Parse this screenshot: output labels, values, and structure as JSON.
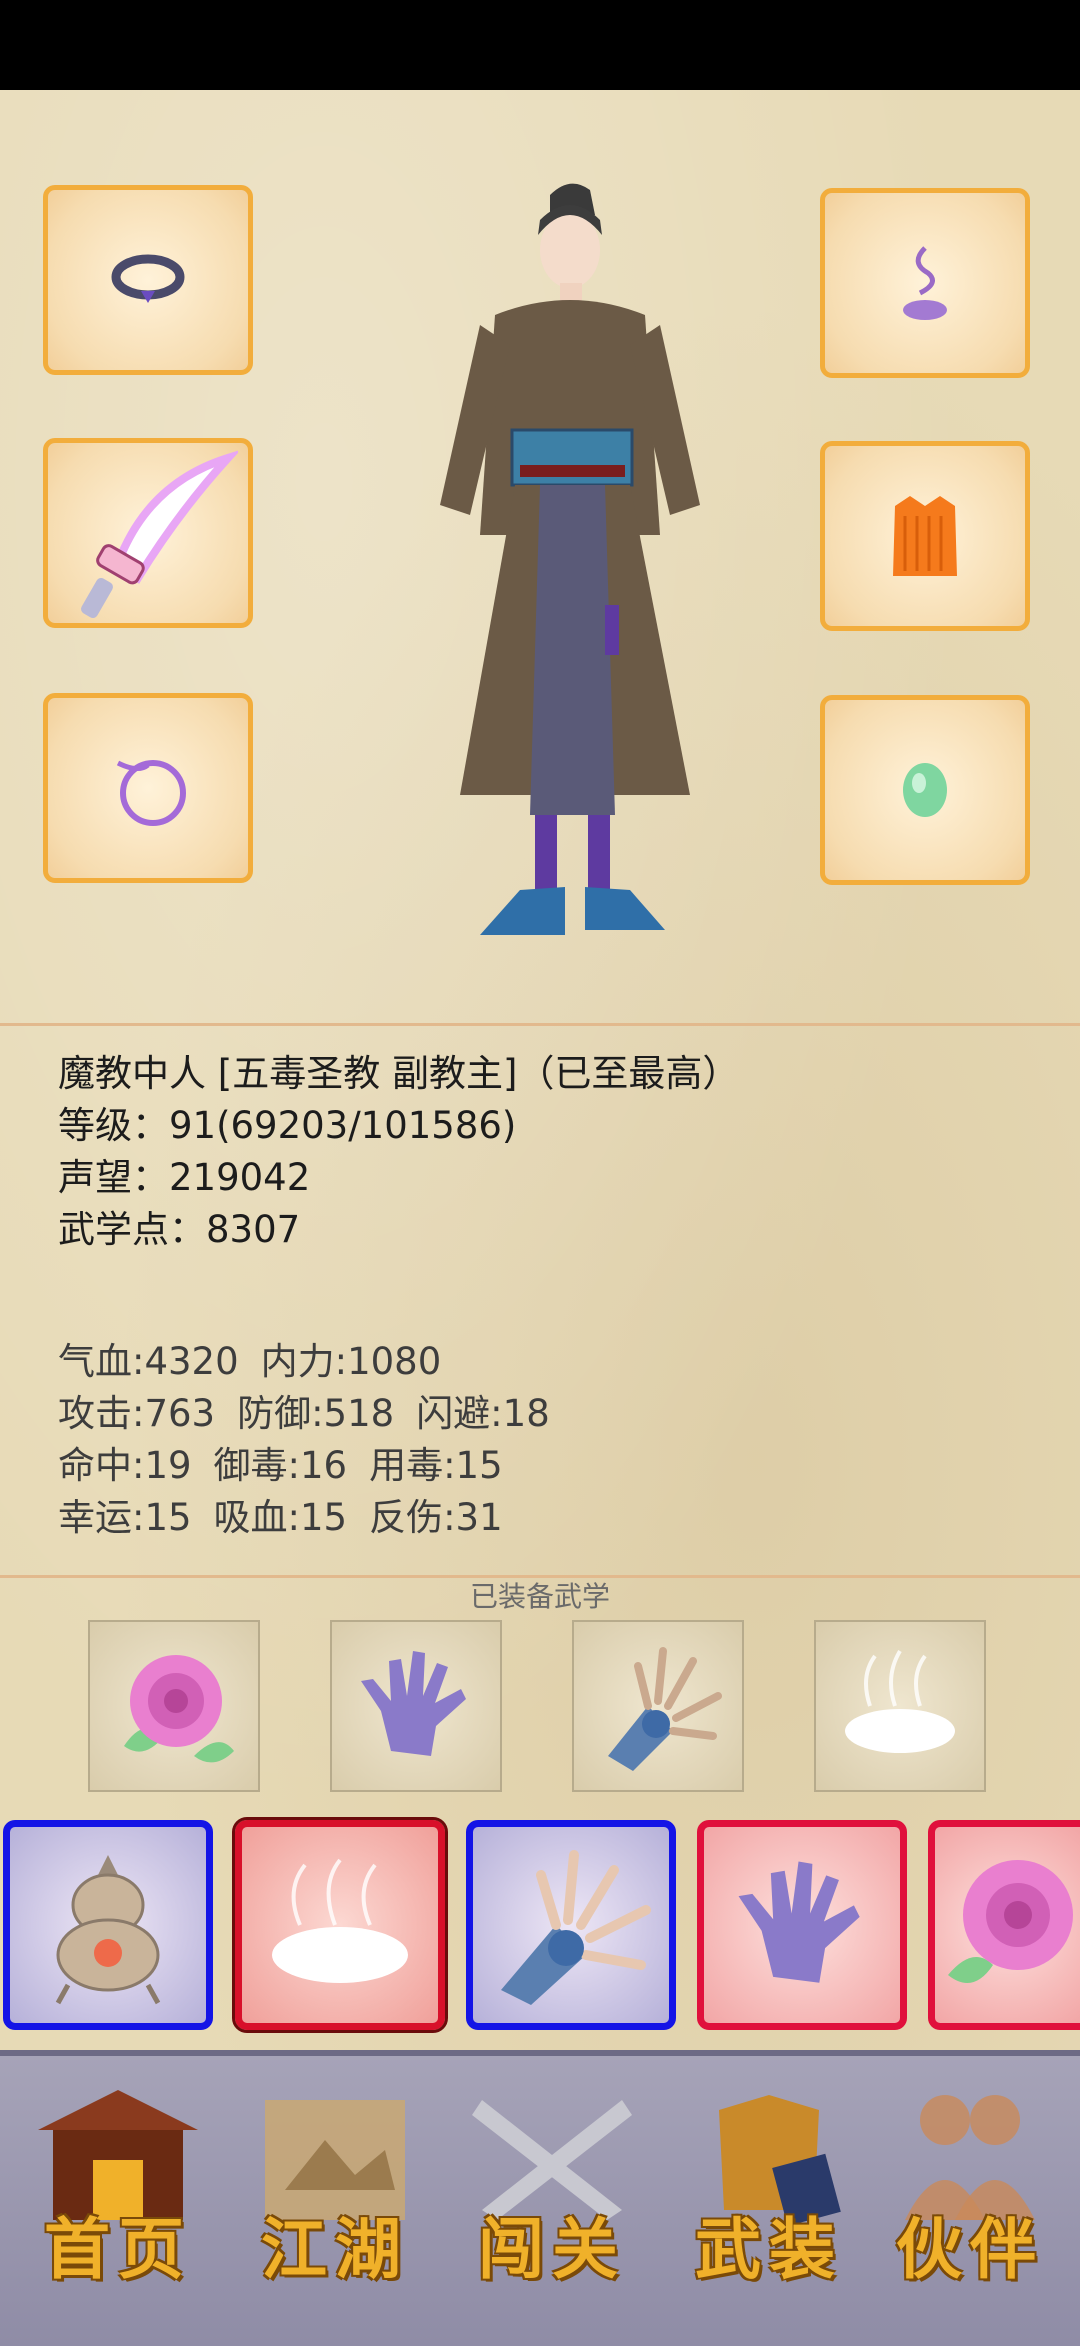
{
  "character": {
    "title_line": "魔教中人 [五毒圣教 副教主]（已至最高）",
    "level_line": "等级：91(69203/101586)",
    "reputation_line": "声望：219042",
    "martial_points_line": "武学点：8307"
  },
  "stats": {
    "row1": [
      "气血:4320",
      "内力:1080"
    ],
    "row2": [
      "攻击:763",
      "防御:518",
      "闪避:18"
    ],
    "row3": [
      "命中:19",
      "御毒:16",
      "用毒:15"
    ],
    "row4": [
      "幸运:15",
      "吸血:15",
      "反伤:31"
    ]
  },
  "equipped_title": "已装备武学",
  "equipment_slots": {
    "left": [
      "ring-icon",
      "sword-icon",
      "bracelet-icon"
    ],
    "right": [
      "incense-icon",
      "cloth-icon",
      "jade-icon"
    ]
  },
  "equipped_skills": [
    "rose-icon",
    "palm-icon",
    "claw-icon",
    "mist-icon"
  ],
  "skill_cards": [
    {
      "icon": "cauldron-icon",
      "color": "blue"
    },
    {
      "icon": "mist-icon",
      "color": "redframe"
    },
    {
      "icon": "claw-icon",
      "color": "blue"
    },
    {
      "icon": "palm-icon",
      "color": "red"
    },
    {
      "icon": "rose-icon",
      "color": "red"
    }
  ],
  "nav": [
    {
      "label": "首页",
      "icon": "house-icon"
    },
    {
      "label": "江湖",
      "icon": "scroll-icon"
    },
    {
      "label": "闯关",
      "icon": "crossed-swords-icon"
    },
    {
      "label": "武装",
      "icon": "armor-icon"
    },
    {
      "label": "伙伴",
      "icon": "partners-icon"
    }
  ],
  "colors": {
    "slot_border": "#f2ad3c",
    "card_blue": "#1414e6",
    "card_red": "#e0103c",
    "nav_gold": "#f0b12a"
  }
}
